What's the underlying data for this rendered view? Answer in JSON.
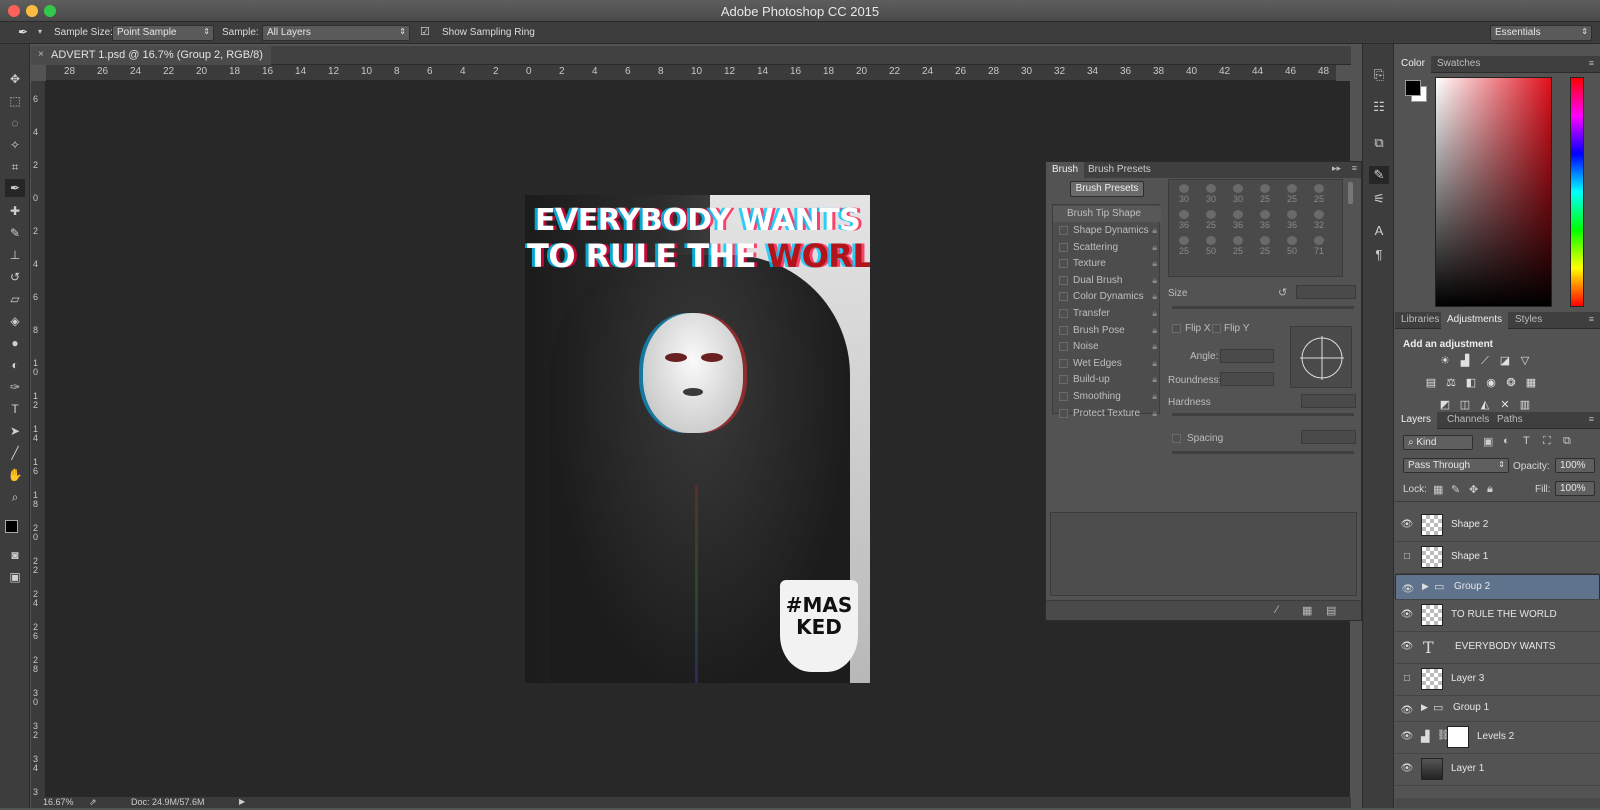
{
  "app": {
    "title": "Adobe Photoshop CC 2015",
    "workspace": "Essentials",
    "traffic_colors": [
      "#fc605b",
      "#fdbc40",
      "#34c84a"
    ]
  },
  "options_bar": {
    "sample_size_label": "Sample Size:",
    "sample_size_value": "Point Sample",
    "sample_label": "Sample:",
    "sample_value": "All Layers",
    "show_ring_label": "Show Sampling Ring",
    "show_ring_checked": true
  },
  "tools": [
    "move-tool",
    "marquee-tool",
    "lasso-tool",
    "magic-wand-tool",
    "crop-tool",
    "eyedropper-tool",
    "healing-brush-tool",
    "brush-tool",
    "clone-stamp-tool",
    "history-brush-tool",
    "eraser-tool",
    "paint-bucket-tool",
    "blur-tool",
    "dodge-tool",
    "pen-tool",
    "type-tool",
    "path-selection-tool",
    "line-tool",
    "hand-tool",
    "zoom-tool"
  ],
  "document": {
    "tab_title": "ADVERT 1.psd @ 16.7% (Group 2, RGB/8)",
    "h_ruler": [
      "28",
      "26",
      "24",
      "22",
      "20",
      "18",
      "16",
      "14",
      "12",
      "10",
      "8",
      "6",
      "4",
      "2",
      "0",
      "2",
      "4",
      "6",
      "8",
      "10",
      "12",
      "14",
      "16",
      "18",
      "20",
      "22",
      "24",
      "26",
      "28",
      "30",
      "32",
      "34",
      "36",
      "38",
      "40",
      "42",
      "44",
      "46",
      "48"
    ],
    "v_ruler": [
      "6",
      "4",
      "2",
      "0",
      "2",
      "4",
      "6",
      "8",
      "1 0",
      "1 2",
      "1 4",
      "1 6",
      "1 8",
      "2 0",
      "2 2",
      "2 4",
      "2 6",
      "2 8",
      "3 0",
      "3 2",
      "3 4",
      "3"
    ],
    "zoom": "16.67%",
    "doc_size": "Doc: 24.9M/57.6M"
  },
  "artwork": {
    "line1": "EVERYBODY WANTS",
    "line2a": "TO RULE THE ",
    "line2b": "WORLD",
    "logo_line1": "#MAS",
    "logo_line2": "KED"
  },
  "brush_panel": {
    "tabs": [
      "Brush",
      "Brush Presets"
    ],
    "presets_button": "Brush Presets",
    "tip_shape_label": "Brush Tip Shape",
    "options": [
      "Shape Dynamics",
      "Scattering",
      "Texture",
      "Dual Brush",
      "Color Dynamics",
      "Transfer",
      "Brush Pose",
      "Noise",
      "Wet Edges",
      "Build-up",
      "Smoothing",
      "Protect Texture"
    ],
    "tip_sizes": [
      "30",
      "30",
      "30",
      "25",
      "25",
      "25",
      "36",
      "25",
      "36",
      "36",
      "36",
      "32",
      "25",
      "50",
      "25",
      "25",
      "50",
      "71"
    ],
    "size_label": "Size",
    "flip_x": "Flip X",
    "flip_y": "Flip Y",
    "angle_label": "Angle:",
    "roundness_label": "Roundness:",
    "hardness_label": "Hardness",
    "spacing_label": "Spacing"
  },
  "color_panel": {
    "tabs": [
      "Color",
      "Swatches"
    ],
    "foreground": "#000000",
    "background": "#ffffff"
  },
  "adjustments_panel": {
    "tabs": [
      "Libraries",
      "Adjustments",
      "Styles"
    ],
    "heading": "Add an adjustment"
  },
  "layers_panel": {
    "tabs": [
      "Layers",
      "Channels",
      "Paths"
    ],
    "filter_kind": "Kind",
    "blend_mode": "Pass Through",
    "opacity_label": "Opacity:",
    "opacity_value": "100%",
    "lock_label": "Lock:",
    "fill_label": "Fill:",
    "fill_value": "100%",
    "layers": [
      {
        "name": "Shape 2",
        "visible": true,
        "type": "shape"
      },
      {
        "name": "Shape 1",
        "visible": false,
        "type": "shape"
      },
      {
        "name": "Group 2",
        "visible": true,
        "type": "group",
        "selected": true
      },
      {
        "name": "TO RULE THE WORLD",
        "visible": true,
        "type": "raster"
      },
      {
        "name": "EVERYBODY WANTS",
        "visible": true,
        "type": "text"
      },
      {
        "name": "Layer 3",
        "visible": false,
        "type": "raster"
      },
      {
        "name": "Group 1",
        "visible": true,
        "type": "group"
      },
      {
        "name": "Levels 2",
        "visible": true,
        "type": "adjustment"
      },
      {
        "name": "Layer 1",
        "visible": true,
        "type": "photo"
      }
    ]
  }
}
